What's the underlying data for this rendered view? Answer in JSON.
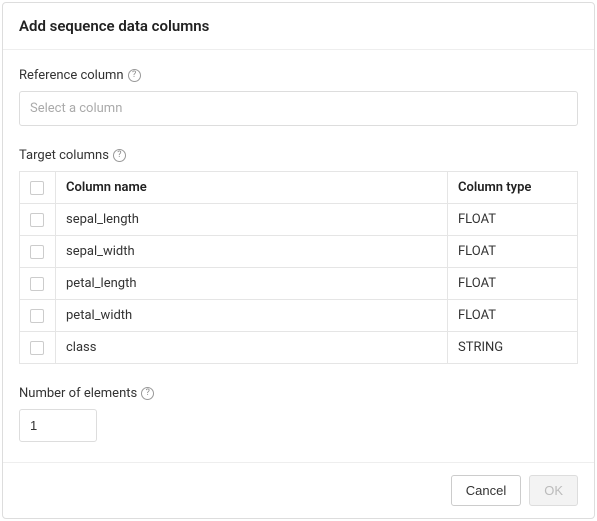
{
  "dialog": {
    "title": "Add sequence data columns"
  },
  "reference": {
    "label": "Reference column",
    "placeholder": "Select a column"
  },
  "target": {
    "label": "Target columns",
    "headers": {
      "name": "Column name",
      "type": "Column type"
    },
    "rows": [
      {
        "name": "sepal_length",
        "type": "FLOAT"
      },
      {
        "name": "sepal_width",
        "type": "FLOAT"
      },
      {
        "name": "petal_length",
        "type": "FLOAT"
      },
      {
        "name": "petal_width",
        "type": "FLOAT"
      },
      {
        "name": "class",
        "type": "STRING"
      }
    ]
  },
  "elements": {
    "label": "Number of elements",
    "value": "1"
  },
  "footer": {
    "cancel": "Cancel",
    "ok": "OK"
  }
}
